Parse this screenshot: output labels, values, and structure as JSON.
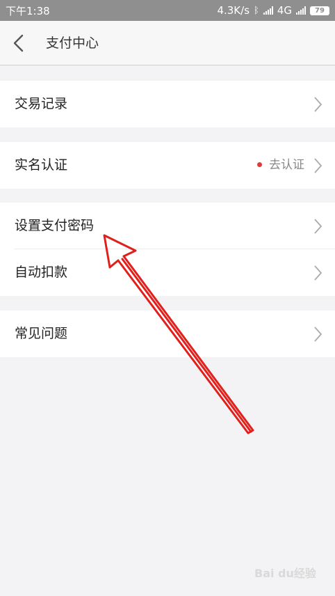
{
  "status_bar": {
    "time": "下午1:38",
    "speed": "4.3K/s",
    "network": "4G",
    "battery": "79"
  },
  "header": {
    "title": "支付中心"
  },
  "menu": {
    "transaction_records": "交易记录",
    "real_name": {
      "label": "实名认证",
      "status": "去认证"
    },
    "set_password": "设置支付密码",
    "auto_debit": "自动扣款",
    "faq": "常见问题"
  },
  "watermark": "Bai du经验",
  "colors": {
    "annotation_arrow": "#e0201c",
    "status_dot": "#e03a3a"
  }
}
